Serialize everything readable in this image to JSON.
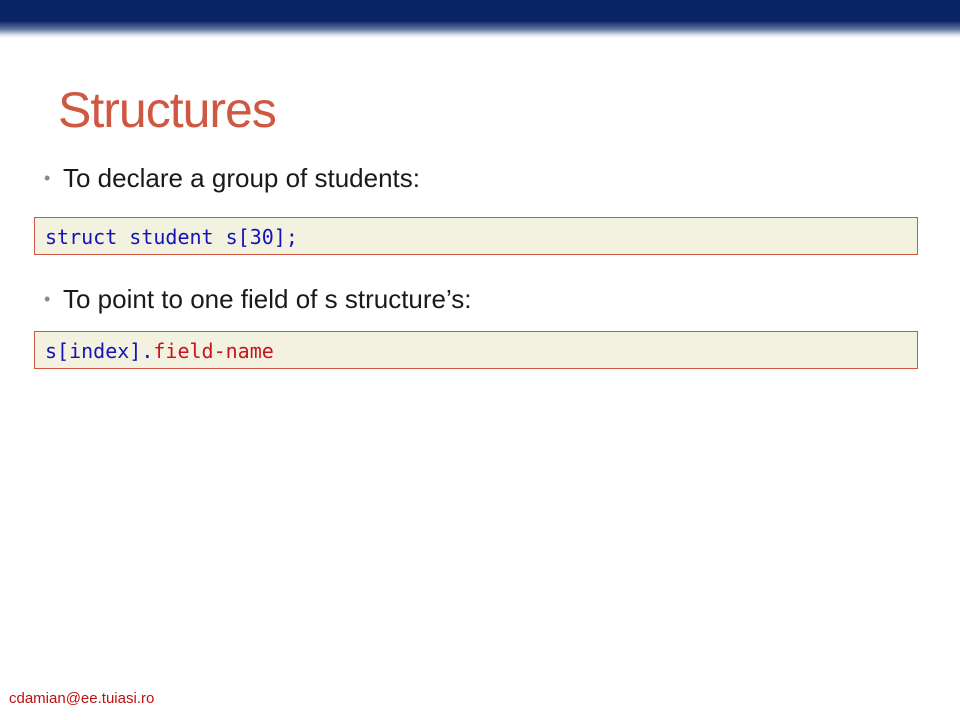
{
  "slide": {
    "title": "Structures",
    "bullets": [
      {
        "text": "To declare a group of students:"
      },
      {
        "text": "To point to one field of s structure’s:"
      }
    ],
    "bullet_glyph": "•",
    "code_blocks": [
      {
        "part1": "struct student s[30];"
      },
      {
        "part1": "s[index].",
        "part2": "field-name"
      }
    ],
    "footer": "cdamian@ee.tuiasi.ro"
  },
  "colors": {
    "header_bar": "#0a2565",
    "title": "#cf5843",
    "code_background": "#f3f1df",
    "code_border": "#cf5843",
    "code_keyword": "#1414b4",
    "code_highlight": "#c8141e",
    "footer": "#c01010"
  }
}
